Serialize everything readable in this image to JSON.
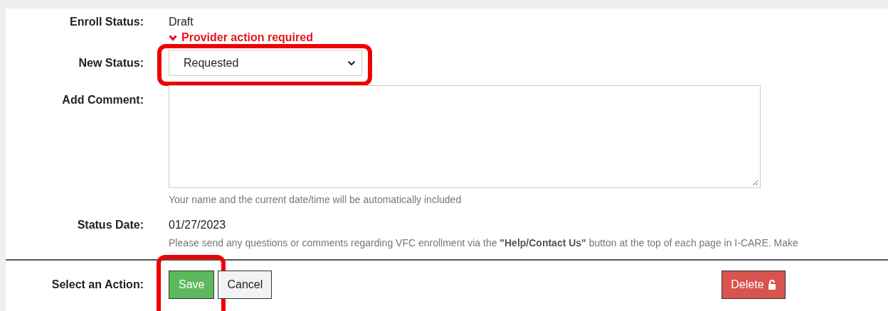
{
  "enroll_status": {
    "label": "Enroll Status:",
    "value": "Draft",
    "warning": "Provider action required"
  },
  "new_status": {
    "label": "New Status:",
    "value": "Requested",
    "highlighted": true
  },
  "comment": {
    "label": "Add Comment:",
    "hint": "Your name and the current date/time will be automatically included"
  },
  "status_date": {
    "label": "Status Date:",
    "value": "01/27/2023",
    "note": "Please send any questions or comments regarding VFC enrollment via the **\"Help/Contact Us\"** button at the top of each page in I-CARE. Make"
  },
  "actions": {
    "label": "Select an Action:",
    "buttons": [
      {
        "label": "Save",
        "kind": "primary",
        "highlighted": true
      },
      {
        "label": "Cancel",
        "kind": "default",
        "highlighted": false
      },
      {
        "label": "Delete",
        "kind": "danger",
        "highlighted": false
      }
    ]
  }
}
